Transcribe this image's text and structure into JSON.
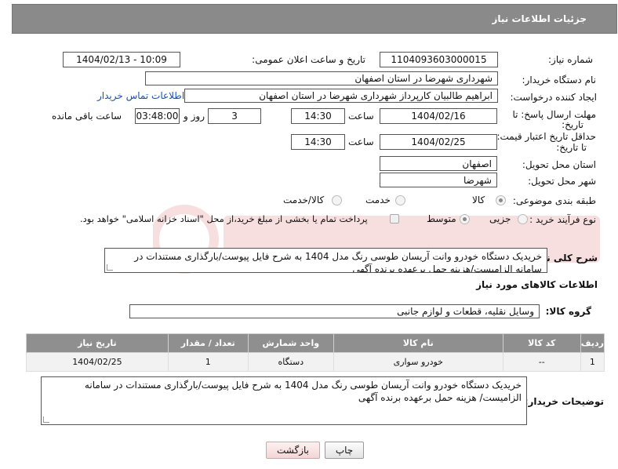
{
  "header": {
    "title": "جزئیات اطلاعات نیاز"
  },
  "fields": {
    "need_number_label": "شماره نیاز:",
    "need_number": "1104093603000015",
    "announce_label": "تاریخ و ساعت اعلان عمومی:",
    "announce_value": "1404/02/13 - 10:09",
    "buyer_org_label": "نام دستگاه خریدار:",
    "buyer_org": "شهرداری شهرضا در استان اصفهان",
    "creator_label": "ایجاد کننده درخواست:",
    "creator": "ابراهیم طالبیان کارپرداز شهرداری شهرضا در استان اصفهان",
    "contact_link": "اطلاعات تماس خریدار",
    "deadline_label_1": "مهلت ارسال پاسخ: تا",
    "deadline_label_2": "تاریخ:",
    "deadline_date": "1404/02/16",
    "time_label": "ساعت",
    "deadline_time": "14:30",
    "days_value": "3",
    "days_label": "روز و",
    "remaining_time": "03:48:00",
    "remaining_label": "ساعت باقی مانده",
    "validity_label_1": "حداقل تاریخ اعتبار قیمت:",
    "validity_label_2": "تا تاریخ:",
    "validity_date": "1404/02/25",
    "validity_time": "14:30",
    "province_label": "استان محل تحویل:",
    "province": "اصفهان",
    "city_label": "شهر محل تحویل:",
    "city": "شهرضا",
    "category_label": "طبقه بندی موضوعی:",
    "category_options": [
      "کالا",
      "خدمت",
      "کالا/خدمت"
    ],
    "process_label": "نوع فرآیند خرید :",
    "process_options": [
      "جزیی",
      "متوسط"
    ],
    "payment_note": "پرداخت تمام یا بخشی از مبلغ خرید،از محل \"اسناد خزانه اسلامی\" خواهد بود."
  },
  "description": {
    "label": "شرح کلی نیاز:",
    "text": "خریدیک دستگاه خودرو وانت آریسان طوسی رنگ مدل 1404 به شرح فایل پیوست/بارگذاری مستندات در سامانه الزامیست/هزینه حمل برعهده برنده آگهی"
  },
  "goods_section": {
    "title": "اطلاعات کالاهای مورد نیاز",
    "group_label": "گروه کالا:",
    "group_value": "وسایل نقلیه، قطعات و لوازم جانبی"
  },
  "goods_table": {
    "headers": [
      "ردیف",
      "کد کالا",
      "نام کالا",
      "واحد شمارش",
      "تعداد / مقدار",
      "تاریخ نیاز"
    ],
    "rows": [
      [
        "1",
        "--",
        "خودرو سواری",
        "دستگاه",
        "1",
        "1404/02/25"
      ]
    ]
  },
  "buyer_notes": {
    "label": "توضیحات خریدار:",
    "text": "خریدیک دستگاه خودرو وانت آریسان طوسی رنگ مدل 1404 به شرح فایل پیوست/بارگذاری مستندات در سامانه الزامیست/ هزینه حمل برعهده برنده آگهی"
  },
  "buttons": {
    "print": "چاپ",
    "back": "بازگشت"
  },
  "colors": {
    "header_bg": "#8a8a8a",
    "link": "#1a4fb0",
    "back_button": "#f3d6d6"
  }
}
